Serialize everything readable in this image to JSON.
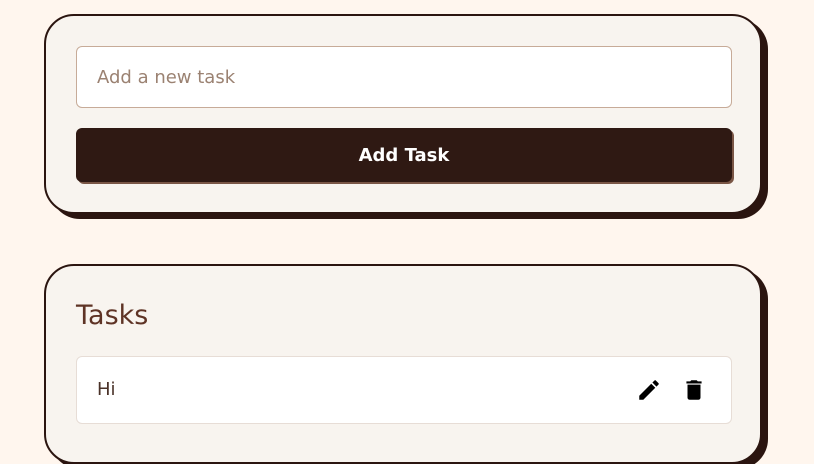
{
  "add_form": {
    "input_value": "",
    "input_placeholder": "Add a new task",
    "add_button_label": "Add Task"
  },
  "task_list": {
    "title": "Tasks",
    "items": [
      {
        "text": "Hi",
        "edit_icon": "pencil-icon",
        "delete_icon": "trash-icon"
      }
    ]
  },
  "colors": {
    "page_background": "#fff6ee",
    "card_background": "#f8f4ef",
    "card_border": "#2b1510",
    "button_background": "#2f1913",
    "title_color": "#5e3325"
  }
}
